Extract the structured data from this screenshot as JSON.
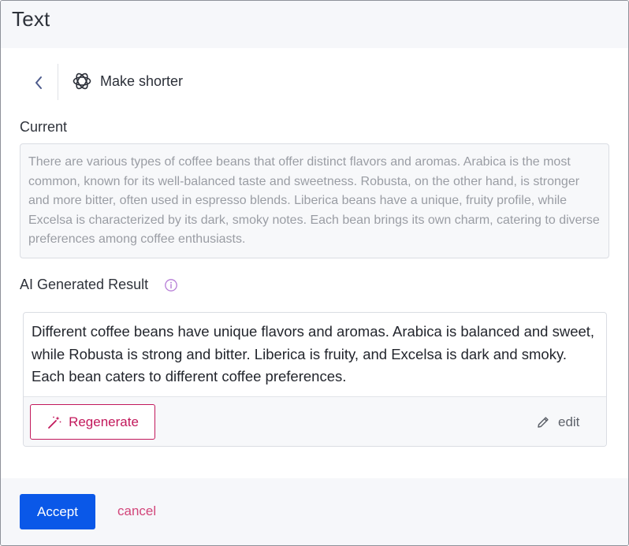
{
  "header": {
    "title": "Text"
  },
  "action": {
    "title": "Make shorter",
    "back_icon": "chevron-left-icon",
    "ai_icon": "openai-logo-icon"
  },
  "current": {
    "label": "Current",
    "text": "There are various types of coffee beans that offer distinct flavors and aromas. Arabica is the most common, known for its well-balanced taste and sweetness. Robusta, on the other hand, is stronger and more bitter, often used in espresso blends. Liberica beans have a unique, fruity profile, while Excelsa is characterized by its dark, smoky notes. Each bean brings its own charm, catering to diverse preferences among coffee enthusiasts."
  },
  "result": {
    "label": "AI Generated Result",
    "info_icon": "info-circle-icon",
    "text": "Different coffee beans have unique flavors and aromas. Arabica is balanced and sweet, while Robusta is strong and bitter. Liberica is fruity, and Excelsa is dark and smoky. Each bean caters to different coffee preferences.",
    "regenerate_label": "Regenerate",
    "regenerate_icon": "magic-wand-icon",
    "edit_label": "edit",
    "edit_icon": "pencil-icon"
  },
  "footer": {
    "accept_label": "Accept",
    "cancel_label": "cancel"
  },
  "colors": {
    "accent": "#0a58e8",
    "regenerate": "#c2185b",
    "cancel": "#d2467a",
    "info": "#b57bd6"
  }
}
